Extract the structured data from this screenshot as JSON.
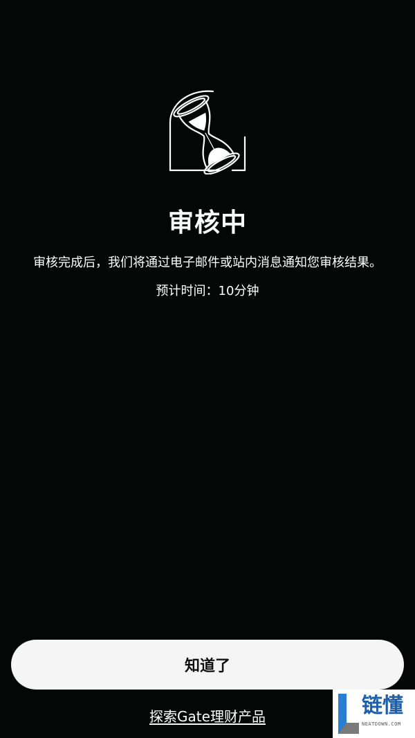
{
  "status": {
    "title": "审核中",
    "description": "审核完成后，我们将通过电子邮件或站内消息通知您审核结果。",
    "eta": "预计时间：10分钟"
  },
  "actions": {
    "ok_label": "知道了",
    "explore_label": "探索Gate理财产品"
  },
  "illustration": {
    "icon": "hourglass-icon"
  },
  "watermark": {
    "name": "链懂",
    "domain": "NEATDOWN.COM"
  },
  "colors": {
    "background": "#050707",
    "text": "#ffffff",
    "button_bg": "#f5f5f5",
    "button_text": "#111111",
    "watermark_blue": "#1f5fa8"
  }
}
